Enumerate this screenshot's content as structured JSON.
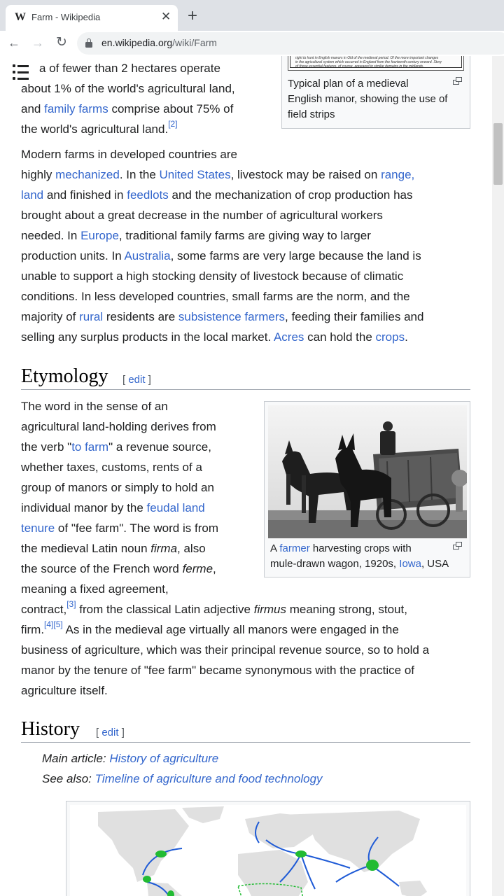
{
  "browser": {
    "tab_title": "Farm - Wikipedia",
    "tab_favicon": "W",
    "close_glyph": "✕",
    "new_tab_glyph": "+",
    "back_glyph": "←",
    "forward_glyph": "→",
    "reload_glyph": "↻",
    "url_host": "en.wikipedia.org",
    "url_path": "/wiki/Farm"
  },
  "intro": {
    "l1": "a of fewer than 2 hectares operate",
    "l2": "about 1% of the world's agricultural land,",
    "l3_pre": "and ",
    "l3_link": "family farms",
    "l3_post": " comprise about 75% of",
    "l4": "the world's agricultural land.",
    "l4_ref": "[2]",
    "fig_caption_l1": "Typical plan of a medieval",
    "fig_caption_l2": "English manor, showing the use of",
    "fig_caption_l3": "field strips",
    "fig_scan_l1": "right to hunt in English manors in Old of the medieval period. Of the more important changes",
    "fig_scan_l2": "in the agricultural system which occurred in England from the fourteenth century onward. Story",
    "fig_scan_l3": "of those essential features, of course, appeared in similar domains in the midlands."
  },
  "para2": {
    "l1": "Modern farms in developed countries are",
    "l2_pre": "highly ",
    "l2_link1": "mechanized",
    "l2_mid": ". In the ",
    "l2_link2": "United States",
    "l2_mid2": ", livestock may be raised on ",
    "l2_link3": "range,",
    "l3_link1": "land",
    "l3_mid": " and finished in ",
    "l3_link2": "feedlots",
    "l3_post": " and the mechanization of crop production has",
    "l4": "brought about a great decrease in the number of agricultural workers",
    "l5_pre": "needed. In ",
    "l5_link": "Europe",
    "l5_post": ", traditional family farms are giving way to larger",
    "l6_pre": "production units. In ",
    "l6_link": "Australia",
    "l6_post": ", some farms are very large because the land is",
    "l7": "unable to support a high stocking density of livestock because of climatic",
    "l8": "conditions. In less developed countries, small farms are the norm, and the",
    "l9_pre": "majority of ",
    "l9_link1": "rural",
    "l9_mid": " residents are ",
    "l9_link2": "subsistence farmers",
    "l9_post": ", feeding their families and",
    "l10_pre": "selling any surplus products in the local market. ",
    "l10_link1": "Acres",
    "l10_mid": " can hold the ",
    "l10_link2": "crops",
    "l10_post": "."
  },
  "etymology": {
    "heading": "Etymology",
    "edit_open": "[ ",
    "edit_label": "edit",
    "edit_close": " ]",
    "l1": "The word in the sense of an",
    "l2": "agricultural land-holding derives from",
    "l3_pre": "the verb \"",
    "l3_link": "to farm",
    "l3_post": "\" a revenue source,",
    "l4": "whether taxes, customs, rents of a",
    "l5": "group of manors or simply to hold an",
    "l6_pre": "individual manor by the ",
    "l6_link": "feudal land",
    "l7_link": "tenure",
    "l7_post": " of \"fee farm\". The word is from",
    "l8_pre": "the medieval Latin noun ",
    "l8_em": "firma",
    "l8_post": ", also",
    "l9_pre": "the source of the French word ",
    "l9_em": "ferme",
    "l9_post": ",",
    "l10": "meaning a fixed agreement,",
    "l11_pre": "contract,",
    "l11_ref": "[3]",
    "l11_mid": " from the classical Latin adjective ",
    "l11_em": "firmus",
    "l11_post": " meaning strong, stout,",
    "l12_pre": "firm.",
    "l12_ref1": "[4]",
    "l12_ref2": "[5]",
    "l12_post": " As in the medieval age virtually all manors were engaged in the",
    "l13": "business of agriculture, which was their principal revenue source, so to hold a",
    "l14": "manor by the tenure of \"fee farm\" became synonymous with the practice of",
    "l15": "agriculture itself.",
    "fig_caption_pre": "A ",
    "fig_caption_link": "farmer",
    "fig_caption_post": " harvesting crops with",
    "fig_caption_l2_pre": "mule-drawn wagon, 1920s, ",
    "fig_caption_l2_link": "Iowa",
    "fig_caption_l2_post": ", USA"
  },
  "history": {
    "heading": "History",
    "edit_open": "[ ",
    "edit_label": "edit",
    "edit_close": " ]",
    "main_label": "Main article: ",
    "main_link": "History of agriculture",
    "see_label": "See also: ",
    "see_link": "Timeline of agriculture and food technology"
  },
  "colors": {
    "link": "#3366cc",
    "text": "#202122",
    "rule": "#a2a9b1",
    "chrome_bg": "#dee1e6",
    "map_land": "#e0e0e0",
    "map_route": "#1f5bd6",
    "map_center": "#22bb33"
  }
}
